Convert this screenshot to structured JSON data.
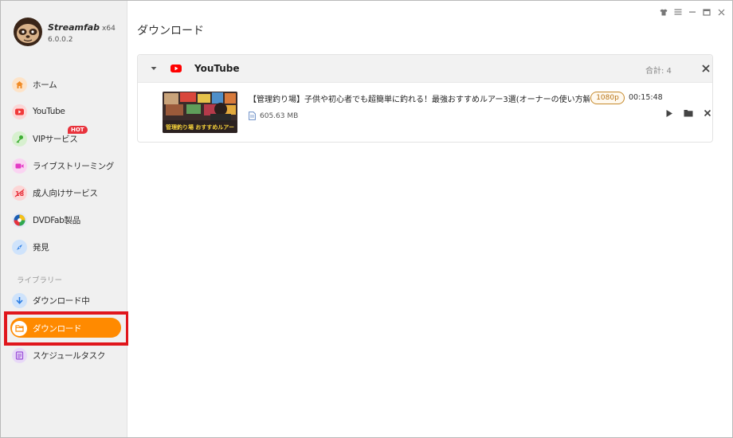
{
  "app": {
    "name": "Streamfab",
    "arch": "x64",
    "version": "6.0.0.2"
  },
  "window_controls": [
    "shirt-icon",
    "menu-icon",
    "minimize-icon",
    "maximize-icon",
    "close-icon"
  ],
  "sidebar": {
    "items": [
      {
        "label": "ホーム",
        "icon": "home-icon"
      },
      {
        "label": "YouTube",
        "icon": "youtube-icon"
      },
      {
        "label": "VIPサービス",
        "icon": "key-icon",
        "badge": "HOT"
      },
      {
        "label": "ライブストリーミング",
        "icon": "live-camera-icon"
      },
      {
        "label": "成人向けサービス",
        "icon": "adult-18-icon"
      },
      {
        "label": "DVDFab製品",
        "icon": "dvdfab-icon"
      },
      {
        "label": "発見",
        "icon": "compass-icon"
      }
    ],
    "library_label": "ライブラリー",
    "library_items": [
      {
        "label": "ダウンロード中",
        "icon": "download-arrow-icon"
      },
      {
        "label": "ダウンロード",
        "icon": "folder-icon",
        "active": true
      },
      {
        "label": "スケジュールタスク",
        "icon": "schedule-list-icon"
      }
    ]
  },
  "main": {
    "title": "ダウンロード",
    "group": {
      "name": "YouTube",
      "count_label": "合計: 4",
      "items": [
        {
          "title": "【管理釣り場】子供や初心者でも超簡単に釣れる！最強おすすめルアー3選(オーナーの使い方解説っ...",
          "quality": "1080p",
          "duration": "00:15:48",
          "size": "605.63 MB",
          "thumb_text": "管理釣り場 おすすめルアー"
        }
      ]
    }
  },
  "colors": {
    "accent": "#ff8a00",
    "highlight": "#e0161c",
    "youtube": "#ff0000",
    "quality_border": "#c68a2c"
  }
}
